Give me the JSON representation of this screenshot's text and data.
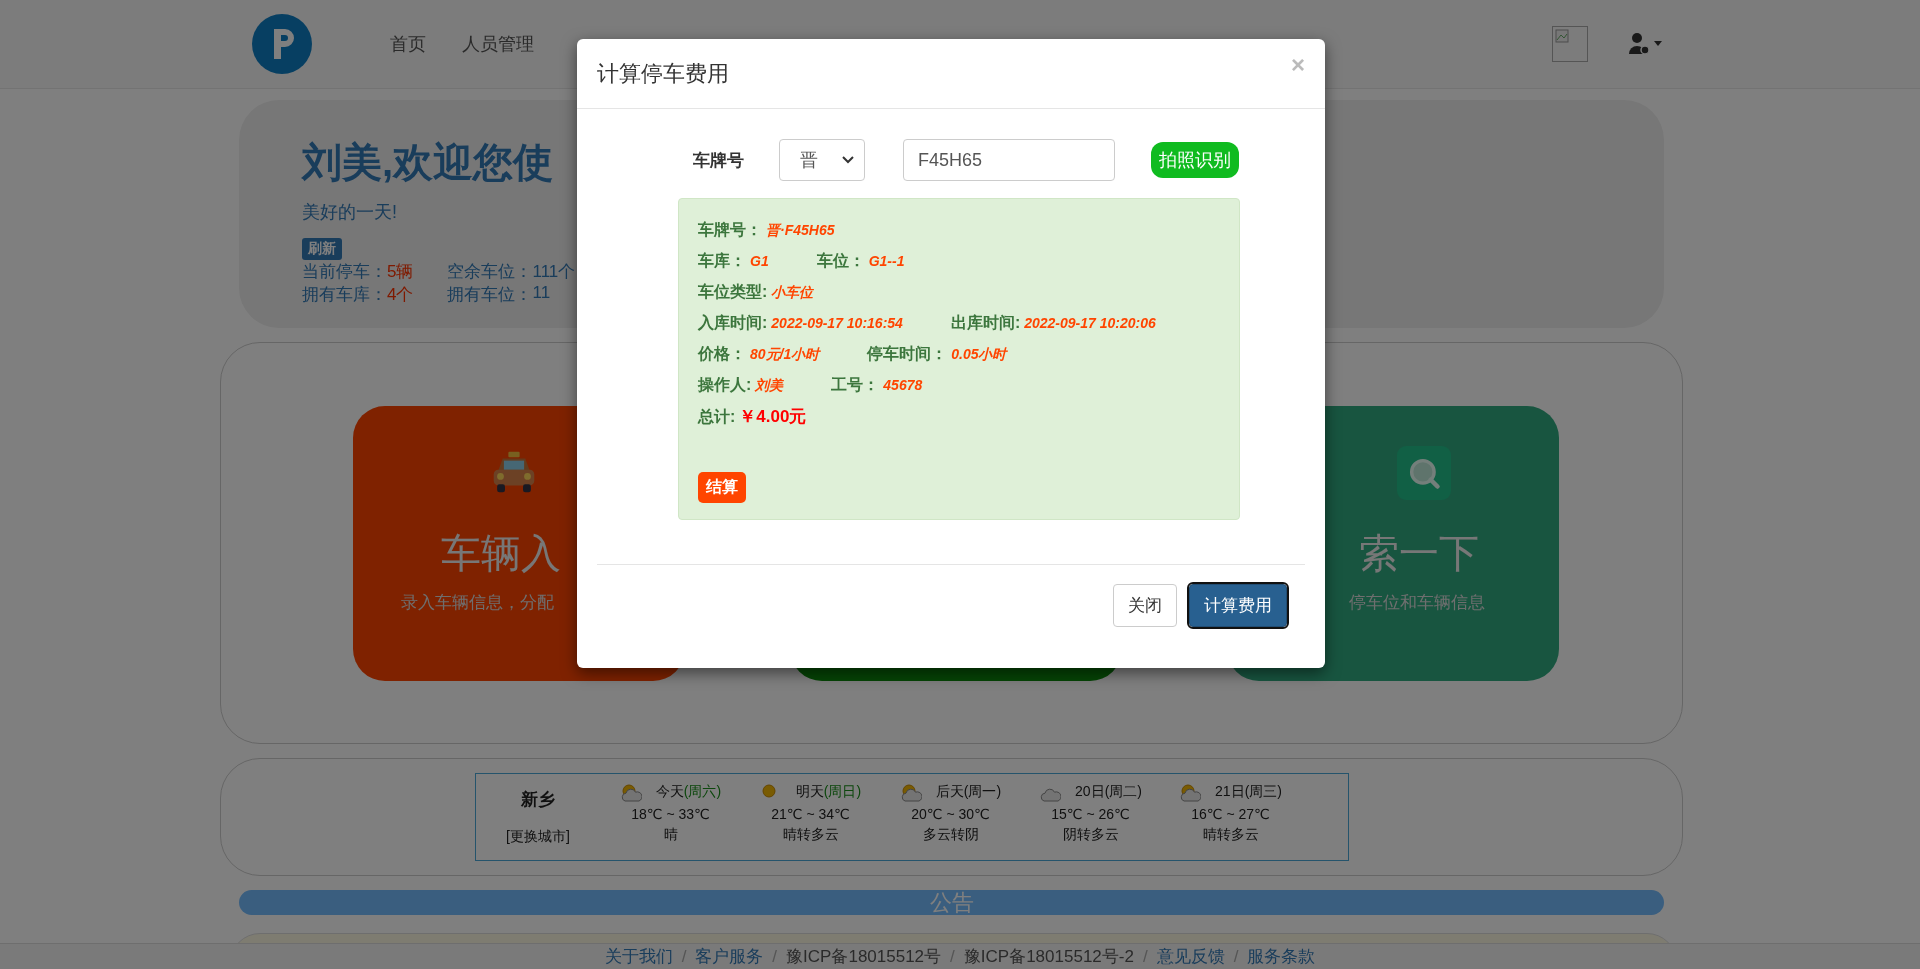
{
  "navbar": {
    "nav_items": [
      "首页",
      "人员管理"
    ]
  },
  "welcome": {
    "title": "刘美,欢迎您使",
    "subtitle": "美好的一天!",
    "refresh_button": "刷新",
    "stats": [
      [
        {
          "label": "当前停车：",
          "value": "5辆"
        },
        {
          "label": "空余车位：",
          "value": "111个"
        }
      ],
      [
        {
          "label": "拥有车库：",
          "value": "4个"
        },
        {
          "label": "拥有车位：",
          "value": "11"
        }
      ]
    ]
  },
  "feature_cards": [
    {
      "kind": "taxi",
      "title": "车辆入",
      "description": "录入车辆信息，分配"
    },
    {
      "kind": "none"
    },
    {
      "kind": "search",
      "title": "索一下",
      "description": "停车位和车辆信息"
    }
  ],
  "weather": {
    "city": "新乡",
    "change_city": "[更换城市]",
    "days": [
      {
        "kind": "partly_cloudy",
        "day": "今天",
        "weekday": "(周六)",
        "weekend": true,
        "temp": "18℃ ~ 33℃",
        "condition": "晴"
      },
      {
        "kind": "sunny",
        "day": "明天",
        "weekday": "(周日)",
        "weekend": true,
        "temp": "21℃ ~ 34℃",
        "condition": "晴转多云"
      },
      {
        "kind": "partly_cloudy",
        "day": "后天",
        "weekday": "(周一)",
        "weekend": false,
        "temp": "20℃ ~ 30℃",
        "condition": "多云转阴"
      },
      {
        "kind": "cloudy",
        "day": "20日",
        "weekday": "(周二)",
        "weekend": false,
        "temp": "15℃ ~ 26℃",
        "condition": "阴转多云"
      },
      {
        "kind": "partly_cloudy",
        "day": "21日",
        "weekday": "(周三)",
        "weekend": false,
        "temp": "16℃ ~ 27℃",
        "condition": "晴转多云"
      }
    ]
  },
  "notice_bar": {
    "title": "公告"
  },
  "footer": [
    {
      "kind": "link",
      "text": "关于我们"
    },
    {
      "kind": "separator",
      "text": "/"
    },
    {
      "kind": "link",
      "text": "客户服务"
    },
    {
      "kind": "separator",
      "text": "/"
    },
    {
      "kind": "text",
      "text": "豫ICP备18015512号"
    },
    {
      "kind": "separator",
      "text": "/"
    },
    {
      "kind": "text",
      "text": "豫ICP备18015512号-2"
    },
    {
      "kind": "separator",
      "text": "/"
    },
    {
      "kind": "link",
      "text": "意见反馈"
    },
    {
      "kind": "separator",
      "text": "/"
    },
    {
      "kind": "link",
      "text": "服务条款"
    }
  ],
  "modal": {
    "title": "计算停车费用",
    "close": "×",
    "plate_label": "车牌号",
    "province": "晋",
    "plate_value": "F45H65",
    "recognize_button": "拍照识别",
    "result_lines": [
      [
        {
          "label": "车牌号：",
          "value": "晋·F45H65"
        }
      ],
      [
        {
          "label": "车库：",
          "value": "G1"
        },
        {
          "label": "车位：",
          "value": "G1--1"
        }
      ],
      [
        {
          "label": "车位类型:",
          "value": "小车位"
        }
      ],
      [
        {
          "label": "入库时间:",
          "value": "2022-09-17 10:16:54"
        },
        {
          "label": "出库时间:",
          "value": "2022-09-17 10:20:06"
        }
      ],
      [
        {
          "label": "价格：",
          "value": "80元/1小时"
        },
        {
          "label": "停车时间：",
          "value": "0.05小时"
        }
      ],
      [
        {
          "label": "操作人:",
          "value": "刘美"
        },
        {
          "label": "工号：",
          "value": "45678"
        }
      ]
    ],
    "total": {
      "label": "总计:",
      "value": "￥4.00元"
    },
    "settle_button": "结算",
    "buttons": [
      {
        "kind": "default",
        "label": "关闭"
      },
      {
        "kind": "primary",
        "label": "计算费用"
      }
    ]
  }
}
